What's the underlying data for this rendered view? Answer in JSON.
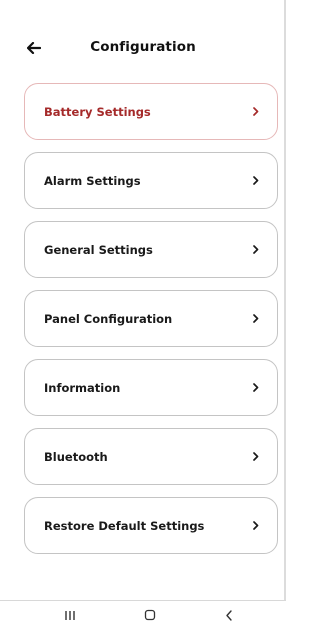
{
  "header": {
    "title": "Configuration",
    "back_icon": "arrow-left-icon"
  },
  "colors": {
    "active_text": "#a52a2a",
    "active_border": "#e6b8b8",
    "border": "#c4c4c4",
    "text": "#1a1a1a"
  },
  "menu": {
    "items": [
      {
        "label": "Battery Settings",
        "active": true
      },
      {
        "label": "Alarm Settings"
      },
      {
        "label": "General Settings"
      },
      {
        "label": "Panel Configuration"
      },
      {
        "label": "Information"
      },
      {
        "label": "Bluetooth"
      },
      {
        "label": "Restore Default Settings"
      }
    ],
    "chevron_icon": "chevron-right-icon"
  },
  "navbar": {
    "icons": [
      "recent-apps-icon",
      "home-icon",
      "back-icon"
    ]
  }
}
